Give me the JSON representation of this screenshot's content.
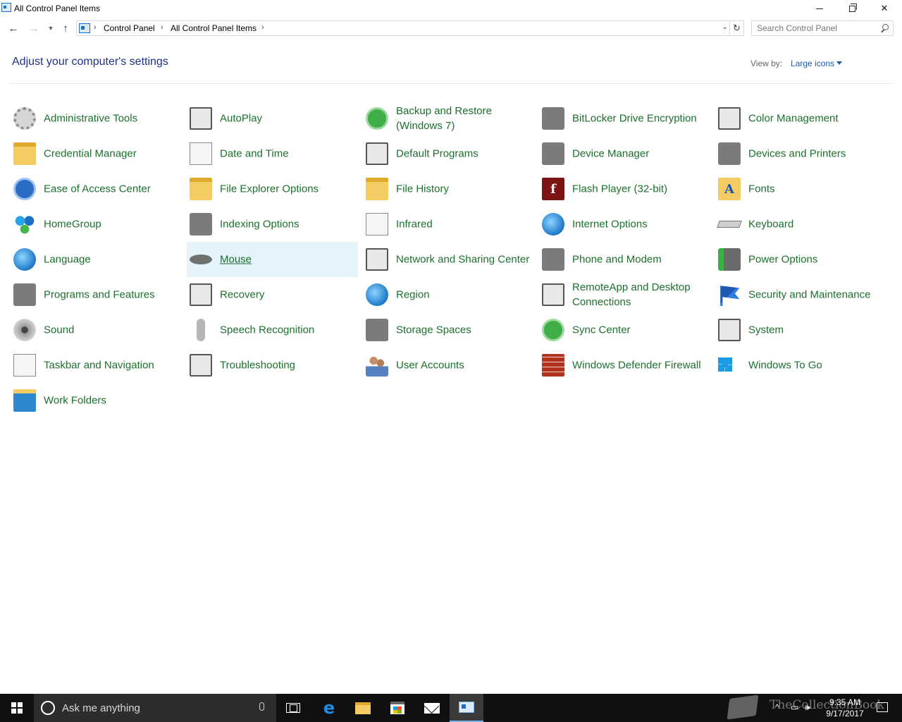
{
  "window": {
    "title": "All Control Panel Items"
  },
  "addressbar": {
    "crumbs": [
      "Control Panel",
      "All Control Panel Items"
    ],
    "search_placeholder": "Search Control Panel"
  },
  "header": {
    "heading": "Adjust your computer's settings",
    "view_by_label": "View by:",
    "view_by_value": "Large icons"
  },
  "items": [
    {
      "label": "Administrative Tools",
      "icon": "administrative-tools-icon"
    },
    {
      "label": "AutoPlay",
      "icon": "autoplay-icon"
    },
    {
      "label": "Backup and Restore (Windows 7)",
      "icon": "backup-restore-icon"
    },
    {
      "label": "BitLocker Drive Encryption",
      "icon": "bitlocker-icon"
    },
    {
      "label": "Color Management",
      "icon": "color-management-icon"
    },
    {
      "label": "Credential Manager",
      "icon": "credential-manager-icon"
    },
    {
      "label": "Date and Time",
      "icon": "date-time-icon"
    },
    {
      "label": "Default Programs",
      "icon": "default-programs-icon"
    },
    {
      "label": "Device Manager",
      "icon": "device-manager-icon"
    },
    {
      "label": "Devices and Printers",
      "icon": "devices-printers-icon"
    },
    {
      "label": "Ease of Access Center",
      "icon": "ease-of-access-icon"
    },
    {
      "label": "File Explorer Options",
      "icon": "file-explorer-options-icon"
    },
    {
      "label": "File History",
      "icon": "file-history-icon"
    },
    {
      "label": "Flash Player (32-bit)",
      "icon": "flash-player-icon"
    },
    {
      "label": "Fonts",
      "icon": "fonts-icon"
    },
    {
      "label": "HomeGroup",
      "icon": "homegroup-icon"
    },
    {
      "label": "Indexing Options",
      "icon": "indexing-options-icon"
    },
    {
      "label": "Infrared",
      "icon": "infrared-icon"
    },
    {
      "label": "Internet Options",
      "icon": "internet-options-icon"
    },
    {
      "label": "Keyboard",
      "icon": "keyboard-icon"
    },
    {
      "label": "Language",
      "icon": "language-icon"
    },
    {
      "label": "Mouse",
      "icon": "mouse-icon"
    },
    {
      "label": "Network and Sharing Center",
      "icon": "network-sharing-icon"
    },
    {
      "label": "Phone and Modem",
      "icon": "phone-modem-icon"
    },
    {
      "label": "Power Options",
      "icon": "power-options-icon"
    },
    {
      "label": "Programs and Features",
      "icon": "programs-features-icon"
    },
    {
      "label": "Recovery",
      "icon": "recovery-icon"
    },
    {
      "label": "Region",
      "icon": "region-icon"
    },
    {
      "label": "RemoteApp and Desktop Connections",
      "icon": "remoteapp-icon"
    },
    {
      "label": "Security and Maintenance",
      "icon": "security-maintenance-icon"
    },
    {
      "label": "Sound",
      "icon": "sound-icon"
    },
    {
      "label": "Speech Recognition",
      "icon": "speech-recognition-icon"
    },
    {
      "label": "Storage Spaces",
      "icon": "storage-spaces-icon"
    },
    {
      "label": "Sync Center",
      "icon": "sync-center-icon"
    },
    {
      "label": "System",
      "icon": "system-icon"
    },
    {
      "label": "Taskbar and Navigation",
      "icon": "taskbar-navigation-icon"
    },
    {
      "label": "Troubleshooting",
      "icon": "troubleshooting-icon"
    },
    {
      "label": "User Accounts",
      "icon": "user-accounts-icon"
    },
    {
      "label": "Windows Defender Firewall",
      "icon": "firewall-icon"
    },
    {
      "label": "Windows To Go",
      "icon": "windows-to-go-icon"
    },
    {
      "label": "Work Folders",
      "icon": "work-folders-icon"
    }
  ],
  "hovered_item": "Mouse",
  "colors": {
    "item_label": "#1c6f2d",
    "heading": "#1e3287",
    "hover_bg": "#e5f3fb",
    "taskbar": "#101010"
  },
  "taskbar": {
    "search_placeholder": "Ask me anything",
    "watermark": "TheCollectionBook",
    "time": "9:35 AM",
    "date": "9/17/2017"
  }
}
